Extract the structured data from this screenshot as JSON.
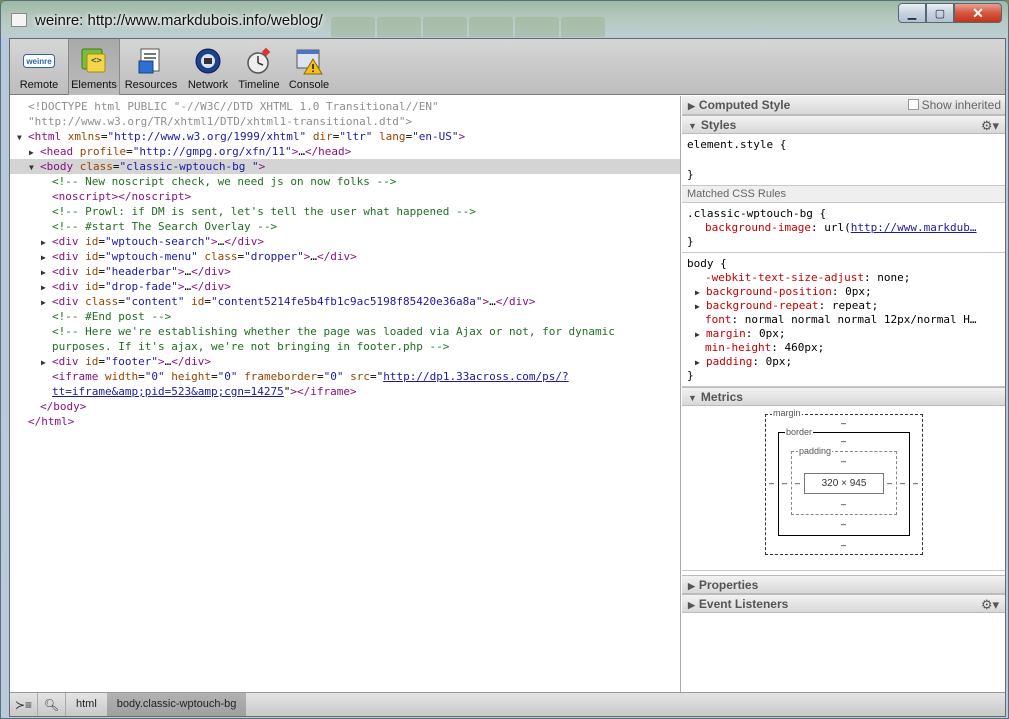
{
  "window": {
    "title": "weinre: http://www.markdubois.info/weblog/",
    "minimize": "▁",
    "maximize": "▢",
    "close": "✕"
  },
  "toolbar": {
    "items": [
      {
        "label": "Remote",
        "icon": "weinre-logo-icon"
      },
      {
        "label": "Elements",
        "icon": "elements-icon"
      },
      {
        "label": "Resources",
        "icon": "resources-icon"
      },
      {
        "label": "Network",
        "icon": "network-icon"
      },
      {
        "label": "Timeline",
        "icon": "timeline-icon"
      },
      {
        "label": "Console",
        "icon": "console-icon"
      }
    ],
    "logo_text": "weinre"
  },
  "dom": {
    "doctype1": "<!DOCTYPE html PUBLIC \"-//W3C//DTD XHTML 1.0 Transitional//EN\"",
    "doctype2": "\"http://www.w3.org/TR/xhtml1/DTD/xhtml1-transitional.dtd\">",
    "html_attrs": {
      "xmlns": "\"http://www.w3.org/1999/xhtml\"",
      "dir": "\"ltr\"",
      "lang": "\"en-US\""
    },
    "head_profile": "\"http://gmpg.org/xfn/11\"",
    "body_class": "\"classic-wptouch-bg \"",
    "comment1": "<!-- New noscript check, we need js on now folks -->",
    "noscript": "<noscript></noscript>",
    "comment2": "<!-- Prowl: if DM is sent, let's tell the user what happened -->",
    "comment3": "<!-- #start The Search Overlay -->",
    "div_search": "\"wptouch-search\"",
    "div_menu": "\"wptouch-menu\"",
    "div_menu_class": "\"dropper\"",
    "div_headerbar": "\"headerbar\"",
    "div_dropfade": "\"drop-fade\"",
    "div_content_class": "\"content\"",
    "div_content_id": "\"content5214fe5b4fb1c9ac5198f85420e36a8a\"",
    "comment4": "<!-- #End post -->",
    "comment5a": "<!-- Here we're establishing whether the page was loaded via Ajax or not, for dynamic",
    "comment5b": "purposes. If it's ajax, we're not bringing in footer.php -->",
    "div_footer": "\"footer\"",
    "iframe_src1": "http://dp1.33across.com/ps/?",
    "iframe_src2": "tt=iframe&amp;pid=523&amp;cgn=14275",
    "close_body": "</body>",
    "close_html": "</html>"
  },
  "sidebar": {
    "computed_style": "Computed Style",
    "show_inherited": "Show inherited",
    "styles": "Styles",
    "element_style": "element.style {",
    "close_brace": "}",
    "matched_rules": "Matched CSS Rules",
    "rule1_selector": ".classic-wptouch-bg {",
    "rule1_prop": "background-image",
    "rule1_val_prefix": "url(",
    "rule1_link": "http://www.markdub…",
    "rule2_selector": "body {",
    "rule2_props": [
      {
        "name": "-webkit-text-size-adjust",
        "value": "none;",
        "expandable": false
      },
      {
        "name": "background-position",
        "value": "0px;",
        "expandable": true
      },
      {
        "name": "background-repeat",
        "value": "repeat;",
        "expandable": true
      },
      {
        "name": "font",
        "value": "normal normal normal 12px/normal H…",
        "expandable": false
      },
      {
        "name": "margin",
        "value": "0px;",
        "expandable": true
      },
      {
        "name": "min-height",
        "value": "460px;",
        "expandable": false
      },
      {
        "name": "padding",
        "value": "0px;",
        "expandable": true
      }
    ],
    "metrics": "Metrics",
    "metrics_labels": {
      "margin": "margin",
      "border": "border",
      "padding": "padding",
      "content": "320 × 945",
      "dash": "–"
    },
    "properties": "Properties",
    "event_listeners": "Event Listeners"
  },
  "bottom": {
    "crumbs": [
      "html",
      "body.classic-wptouch-bg"
    ]
  }
}
